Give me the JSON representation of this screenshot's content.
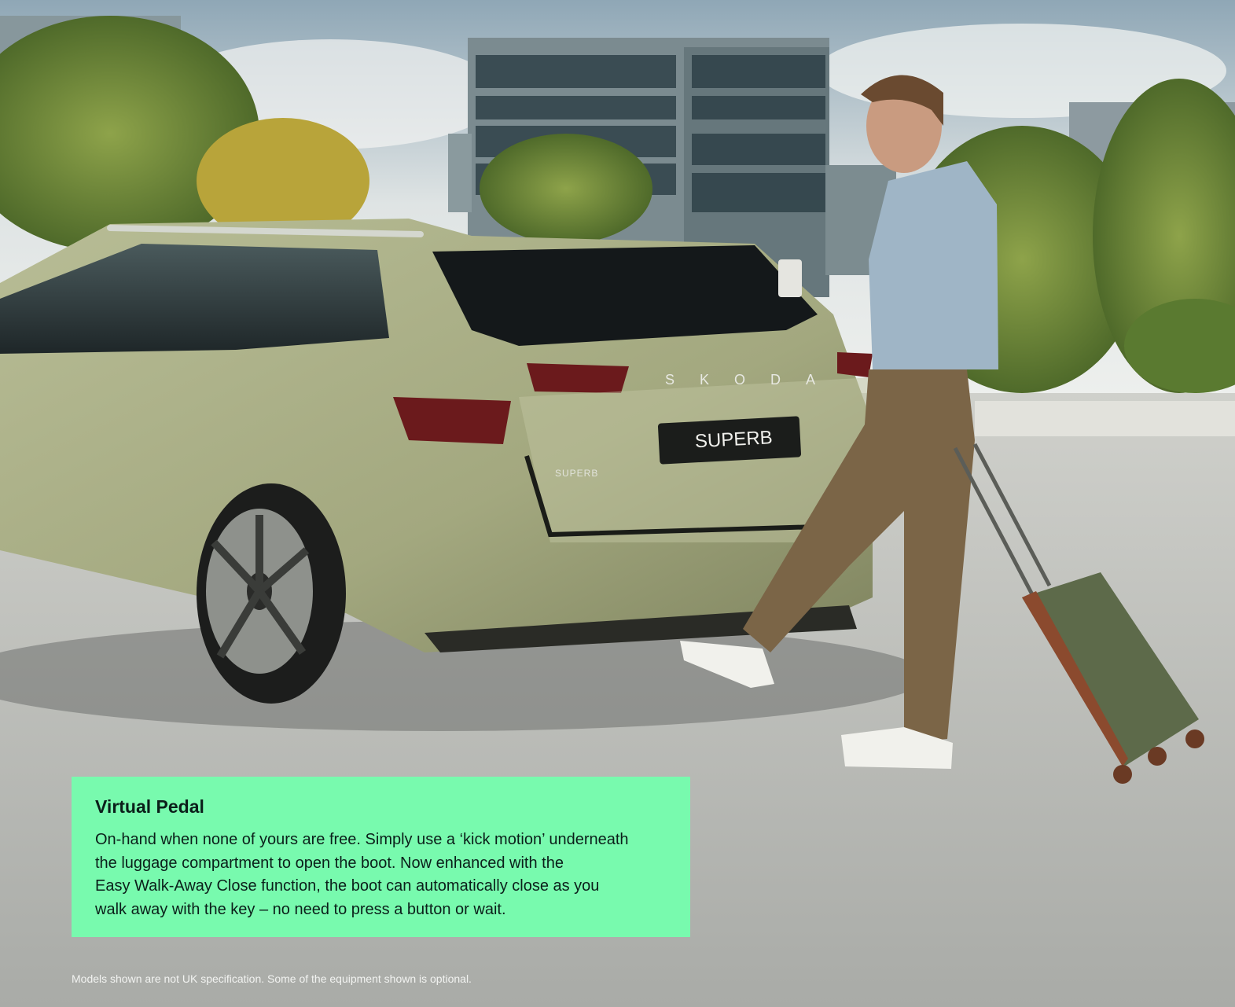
{
  "feature": {
    "title": "Virtual Pedal",
    "body": "On-hand when none of yours are free. Simply use a ‘kick motion’ underneath\nthe luggage compartment to open the boot. Now enhanced with the\nEasy Walk-Away Close function, the boot can automatically close as you\nwalk away with the key – no need to press a button or wait."
  },
  "badge": {
    "brand": "SKODA",
    "model_plate": "SUPERB",
    "model_badge": "SUPERB"
  },
  "disclaimer": "Models shown are not UK specification. Some of the equipment shown is optional.",
  "colors": {
    "panel": "#78faae",
    "car_body": "#a8ad86"
  }
}
